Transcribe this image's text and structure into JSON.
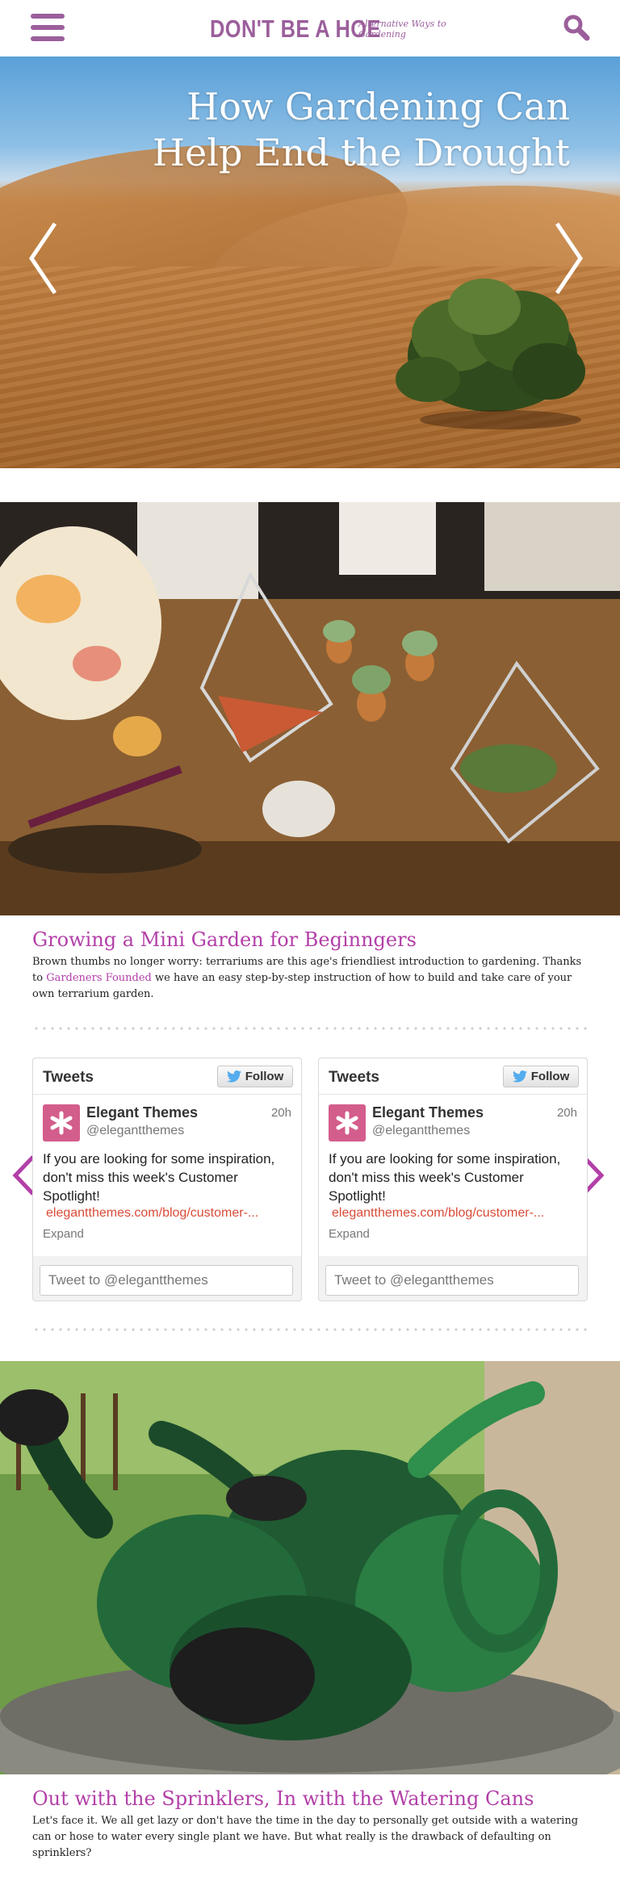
{
  "header": {
    "logo_main": "DON'T BE A HOE",
    "logo_tagline": "Alternative Ways to Gardening",
    "brand_color": "#9b5f9b",
    "menu_icon": "hamburger-menu-icon",
    "search_icon": "search-icon"
  },
  "hero": {
    "title": "How Gardening Can Help End the Drought",
    "prev_icon": "chevron-left-icon",
    "next_icon": "chevron-right-icon"
  },
  "posts": [
    {
      "title": "Growing a Mini Garden for Beginngers",
      "text_before_link": "Brown thumbs no longer worry: terrariums are this age's friendliest introduction to gardening. Thanks to ",
      "link_text": "Gardeners Founded",
      "text_after_link": " we have an easy step-by-step instruction of how to build and take care of your own terrarium garden."
    },
    {
      "title": "Out with the Sprinklers, In with the Watering Cans",
      "text": "Let's face it. We all get lazy or don't have the time in the day to personally get outside with a watering can or hose to water every single plant we have. But what really is the drawback of defaulting on sprinklers?"
    }
  ],
  "accent_color": "#b23fa8",
  "tweets": [
    {
      "header": "Tweets",
      "follow_label": "Follow",
      "name": "Elegant Themes",
      "handle": "@elegantthemes",
      "time": "20h",
      "text": "If you are looking for some inspiration, don't miss this week's Customer Spotlight!",
      "link": "elegantthemes.com/blog/customer-...",
      "expand": "Expand",
      "input_placeholder": "Tweet to @elegantthemes"
    },
    {
      "header": "Tweets",
      "follow_label": "Follow",
      "name": "Elegant Themes",
      "handle": "@elegantthemes",
      "time": "20h",
      "text": "If you are looking for some inspiration, don't miss this week's Customer Spotlight!",
      "link": "elegantthemes.com/blog/customer-...",
      "expand": "Expand",
      "input_placeholder": "Tweet to @elegantthemes"
    }
  ]
}
